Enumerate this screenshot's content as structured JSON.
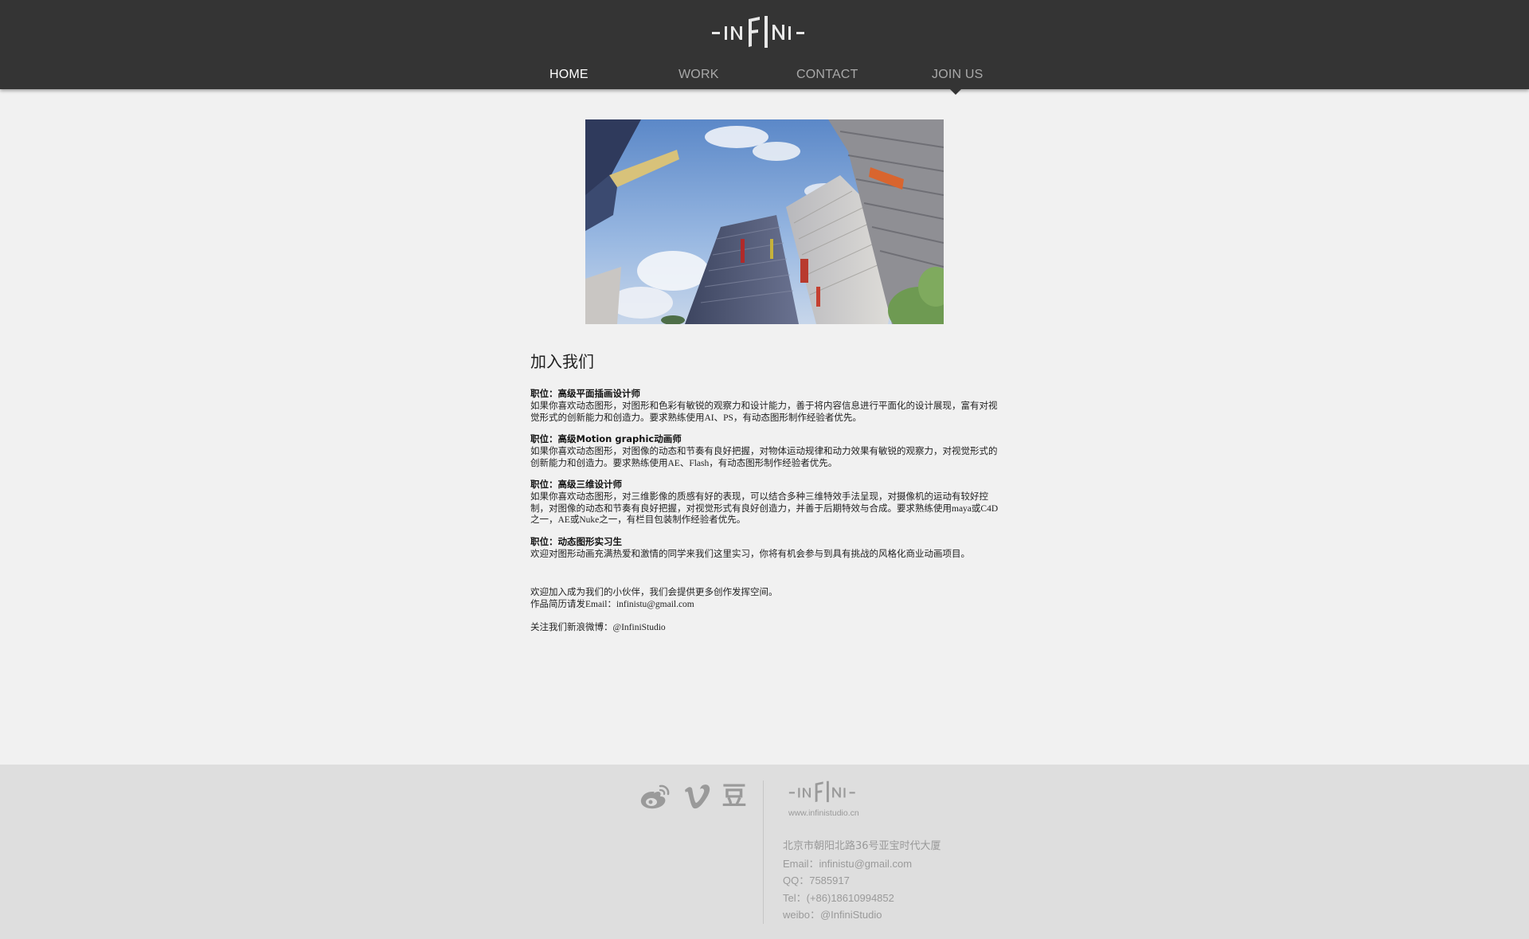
{
  "brand": {
    "logo_text": "-INFIN-",
    "color_header": "#343434",
    "color_page": "#f1f1f1",
    "color_footer": "#dedede"
  },
  "nav": {
    "items": [
      {
        "label": "HOME",
        "active": true
      },
      {
        "label": "WORK",
        "active": false
      },
      {
        "label": "CONTACT",
        "active": false
      },
      {
        "label": "JOIN US",
        "active": false
      }
    ]
  },
  "main": {
    "title": "加入我们",
    "jobs": [
      {
        "title": "职位：高级平面插画设计师",
        "desc": "如果你喜欢动态图形，对图形和色彩有敏锐的观察力和设计能力，善于将内容信息进行平面化的设计展现，富有对视觉形式的创新能力和创造力。要求熟练使用AI、PS，有动态图形制作经验者优先。"
      },
      {
        "title": "职位：高级Motion graphic动画师",
        "desc": "如果你喜欢动态图形，对图像的动态和节奏有良好把握，对物体运动规律和动力效果有敏锐的观察力，对视觉形式的创新能力和创造力。要求熟练使用AE、Flash，有动态图形制作经验者优先。"
      },
      {
        "title": "职位：高级三维设计师",
        "desc": "如果你喜欢动态图形，对三维影像的质感有好的表现，可以结合多种三维特效手法呈现，对摄像机的运动有较好控制，对图像的动态和节奏有良好把握，对视觉形式有良好创造力，并善于后期特效与合成。要求熟练使用maya或C4D之一，AE或Nuke之一，有栏目包装制作经验者优先。"
      },
      {
        "title": "职位：动态图形实习生",
        "desc": "欢迎对图形动画充满热爱和激情的同学来我们这里实习，你将有机会参与到具有挑战的风格化商业动画项目。"
      }
    ],
    "invite": "欢迎加入成为我们的小伙伴，我们会提供更多创作发挥空间。",
    "resume": "作品简历请发Email：infinistu@gmail.com",
    "weibo": "关注我们新浪微博：@InfiniStudio"
  },
  "footer": {
    "social": [
      {
        "name": "weibo",
        "icon": "weibo-icon"
      },
      {
        "name": "vimeo",
        "icon": "vimeo-icon"
      },
      {
        "name": "douban",
        "icon": "douban-icon",
        "glyph": "豆"
      }
    ],
    "url": "www.infinistudio.cn",
    "address": "北京市朝阳北路36号亚宝时代大厦",
    "email": "Email：infinistu@gmail.com",
    "qq": "QQ：7585917",
    "tel": "Tel：(+86)18610994852",
    "weibo": "weibo：@InfiniStudio"
  }
}
